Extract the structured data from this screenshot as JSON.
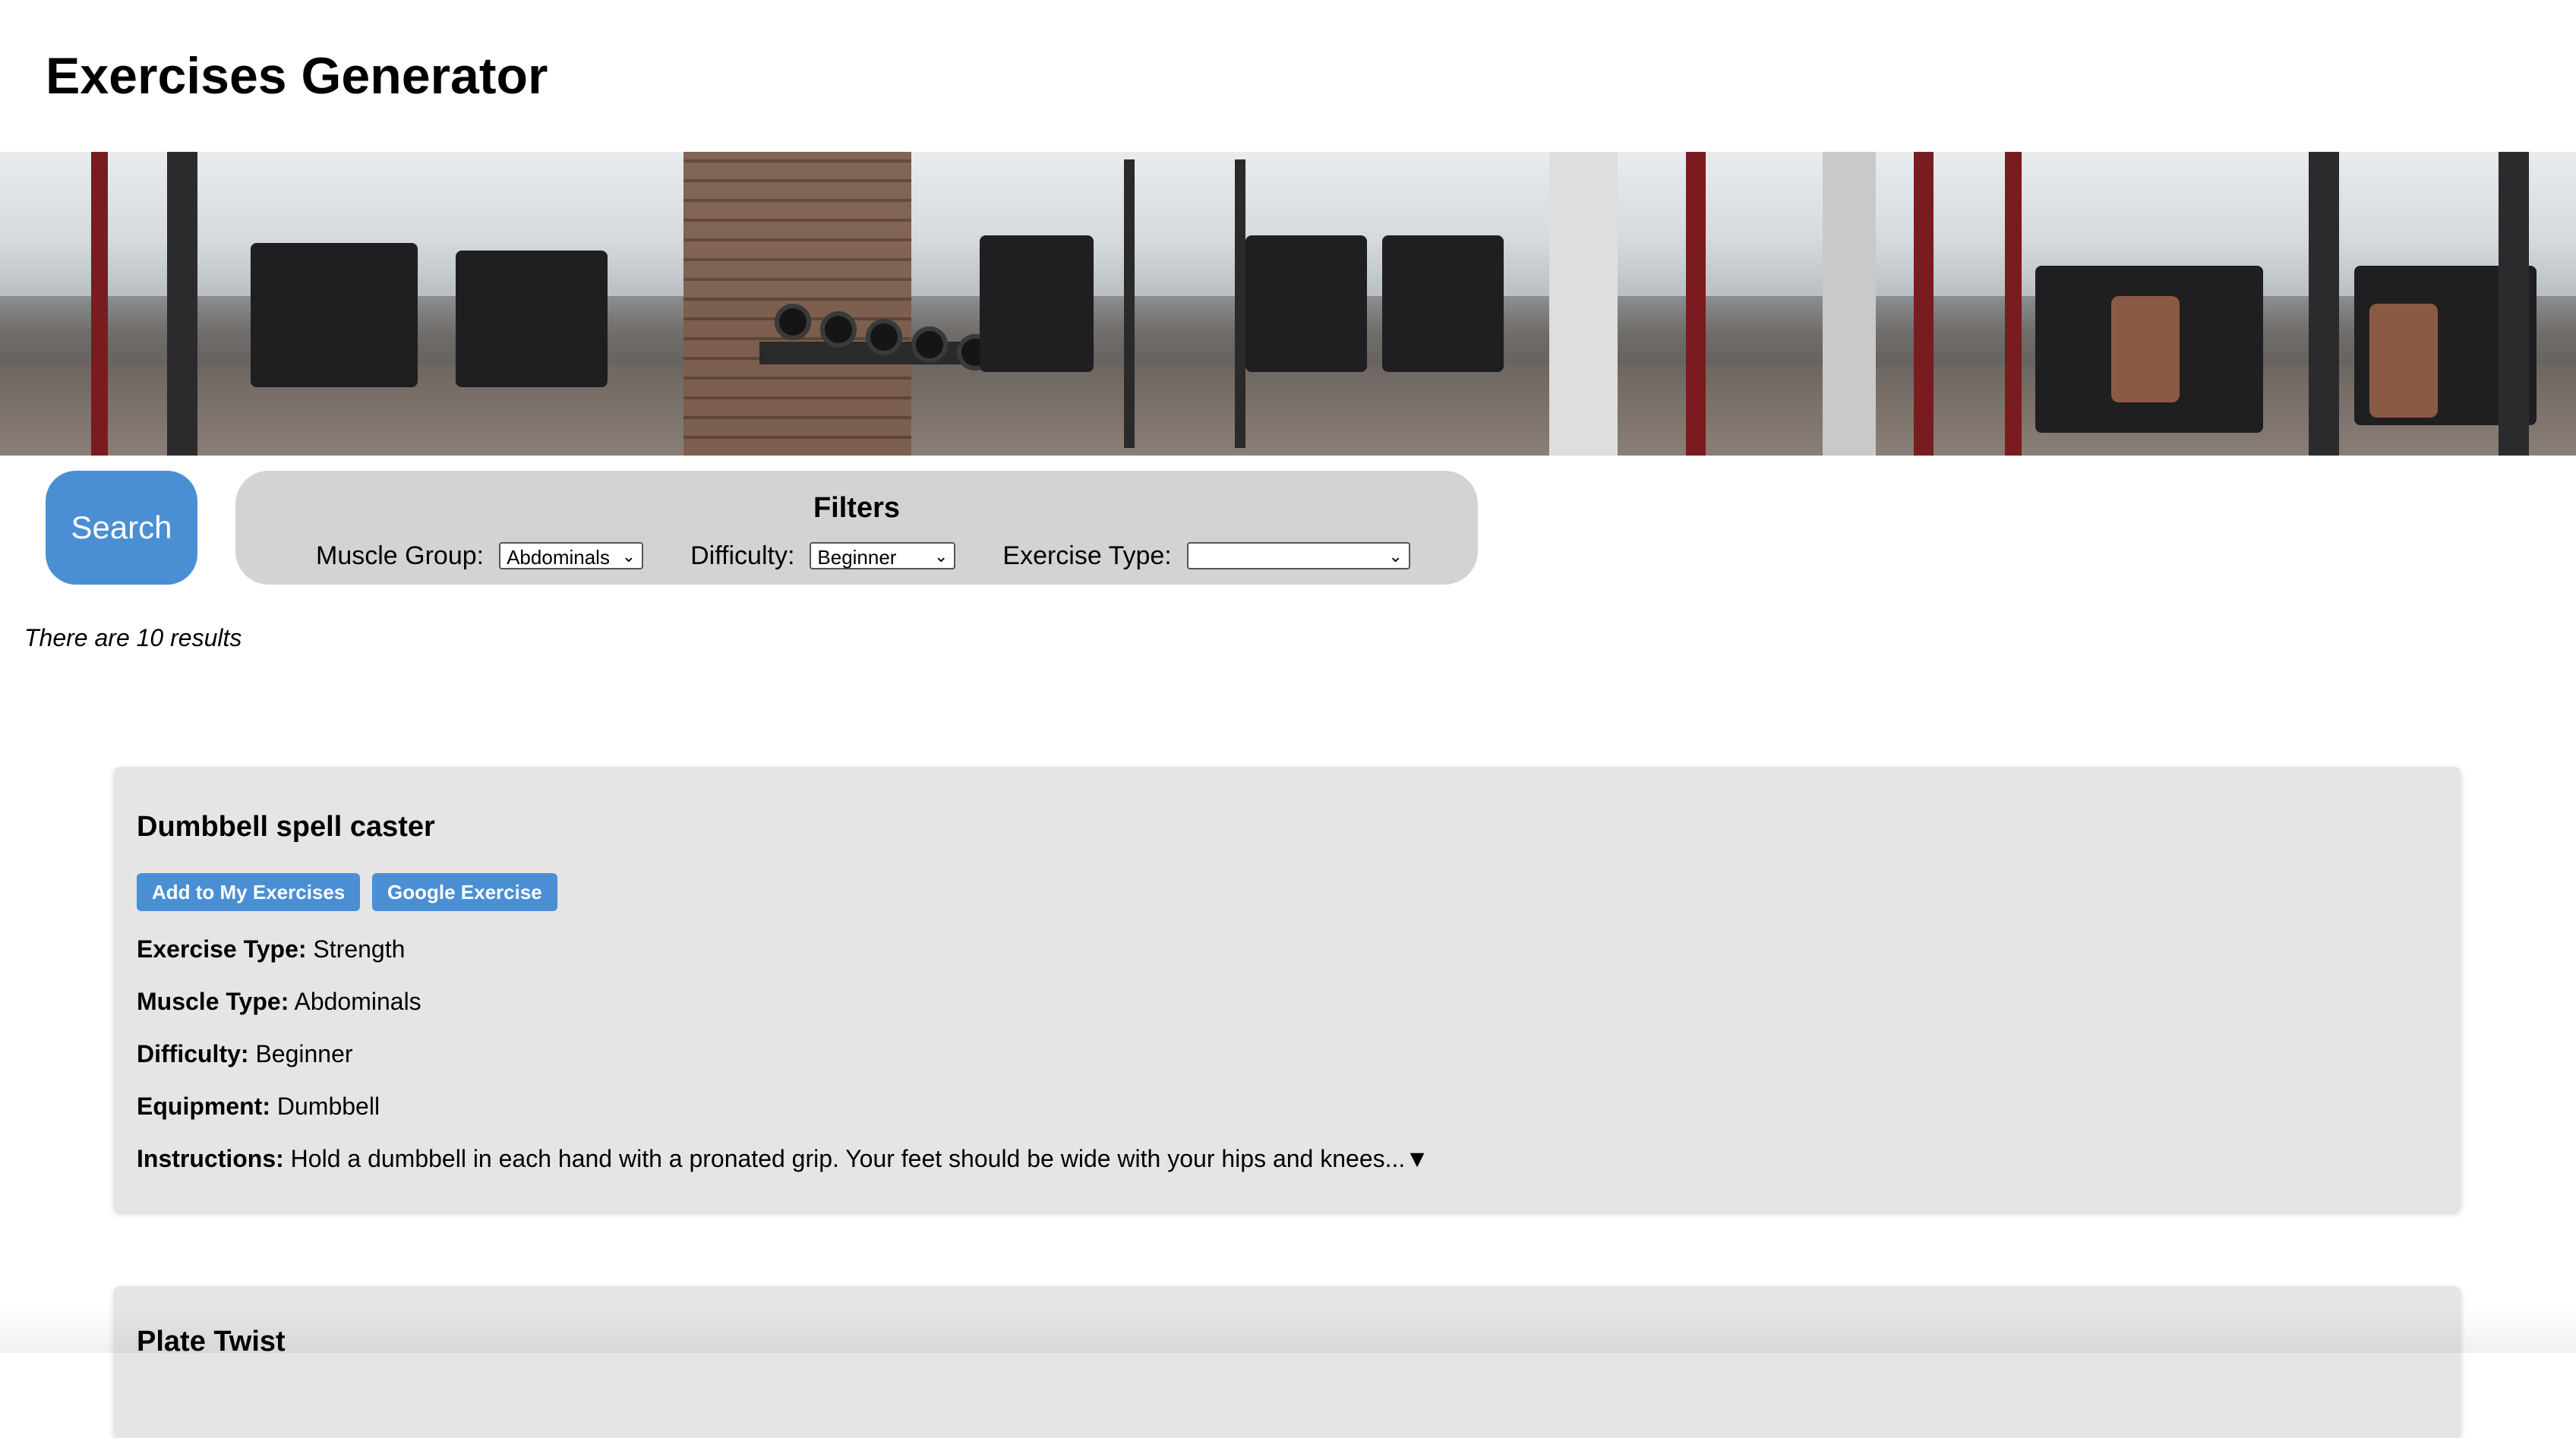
{
  "header": {
    "title": "Exercises Generator"
  },
  "hero": {
    "image": "gym-photo"
  },
  "search": {
    "label": "Search"
  },
  "filters": {
    "title": "Filters",
    "muscle_group": {
      "label": "Muscle Group:",
      "value": "Abdominals"
    },
    "difficulty": {
      "label": "Difficulty:",
      "value": "Beginner"
    },
    "exercise_type": {
      "label": "Exercise Type:",
      "value": ""
    },
    "dropdown_icon": "chevron-down-icon"
  },
  "results": {
    "text": "There are 10 results"
  },
  "labels": {
    "exercise_type": "Exercise Type:",
    "muscle_type": "Muscle Type:",
    "difficulty": "Difficulty:",
    "equipment": "Equipment:",
    "instructions": "Instructions:",
    "add_button": "Add to My Exercises",
    "google_button": "Google Exercise"
  },
  "exercises": [
    {
      "name": "Dumbbell spell caster",
      "exercise_type": "Strength",
      "muscle_type": "Abdominals",
      "difficulty": "Beginner",
      "equipment": "Dumbbell",
      "instructions": "Hold a dumbbell in each hand with a pronated grip. Your feet should be wide with your hips and knees...",
      "expand_glyph": "▼"
    },
    {
      "name": "Plate Twist"
    }
  ],
  "colors": {
    "accent": "#4a8fd4",
    "filters_bg": "#d3d3d3",
    "card_bg": "#e5e5e5"
  }
}
